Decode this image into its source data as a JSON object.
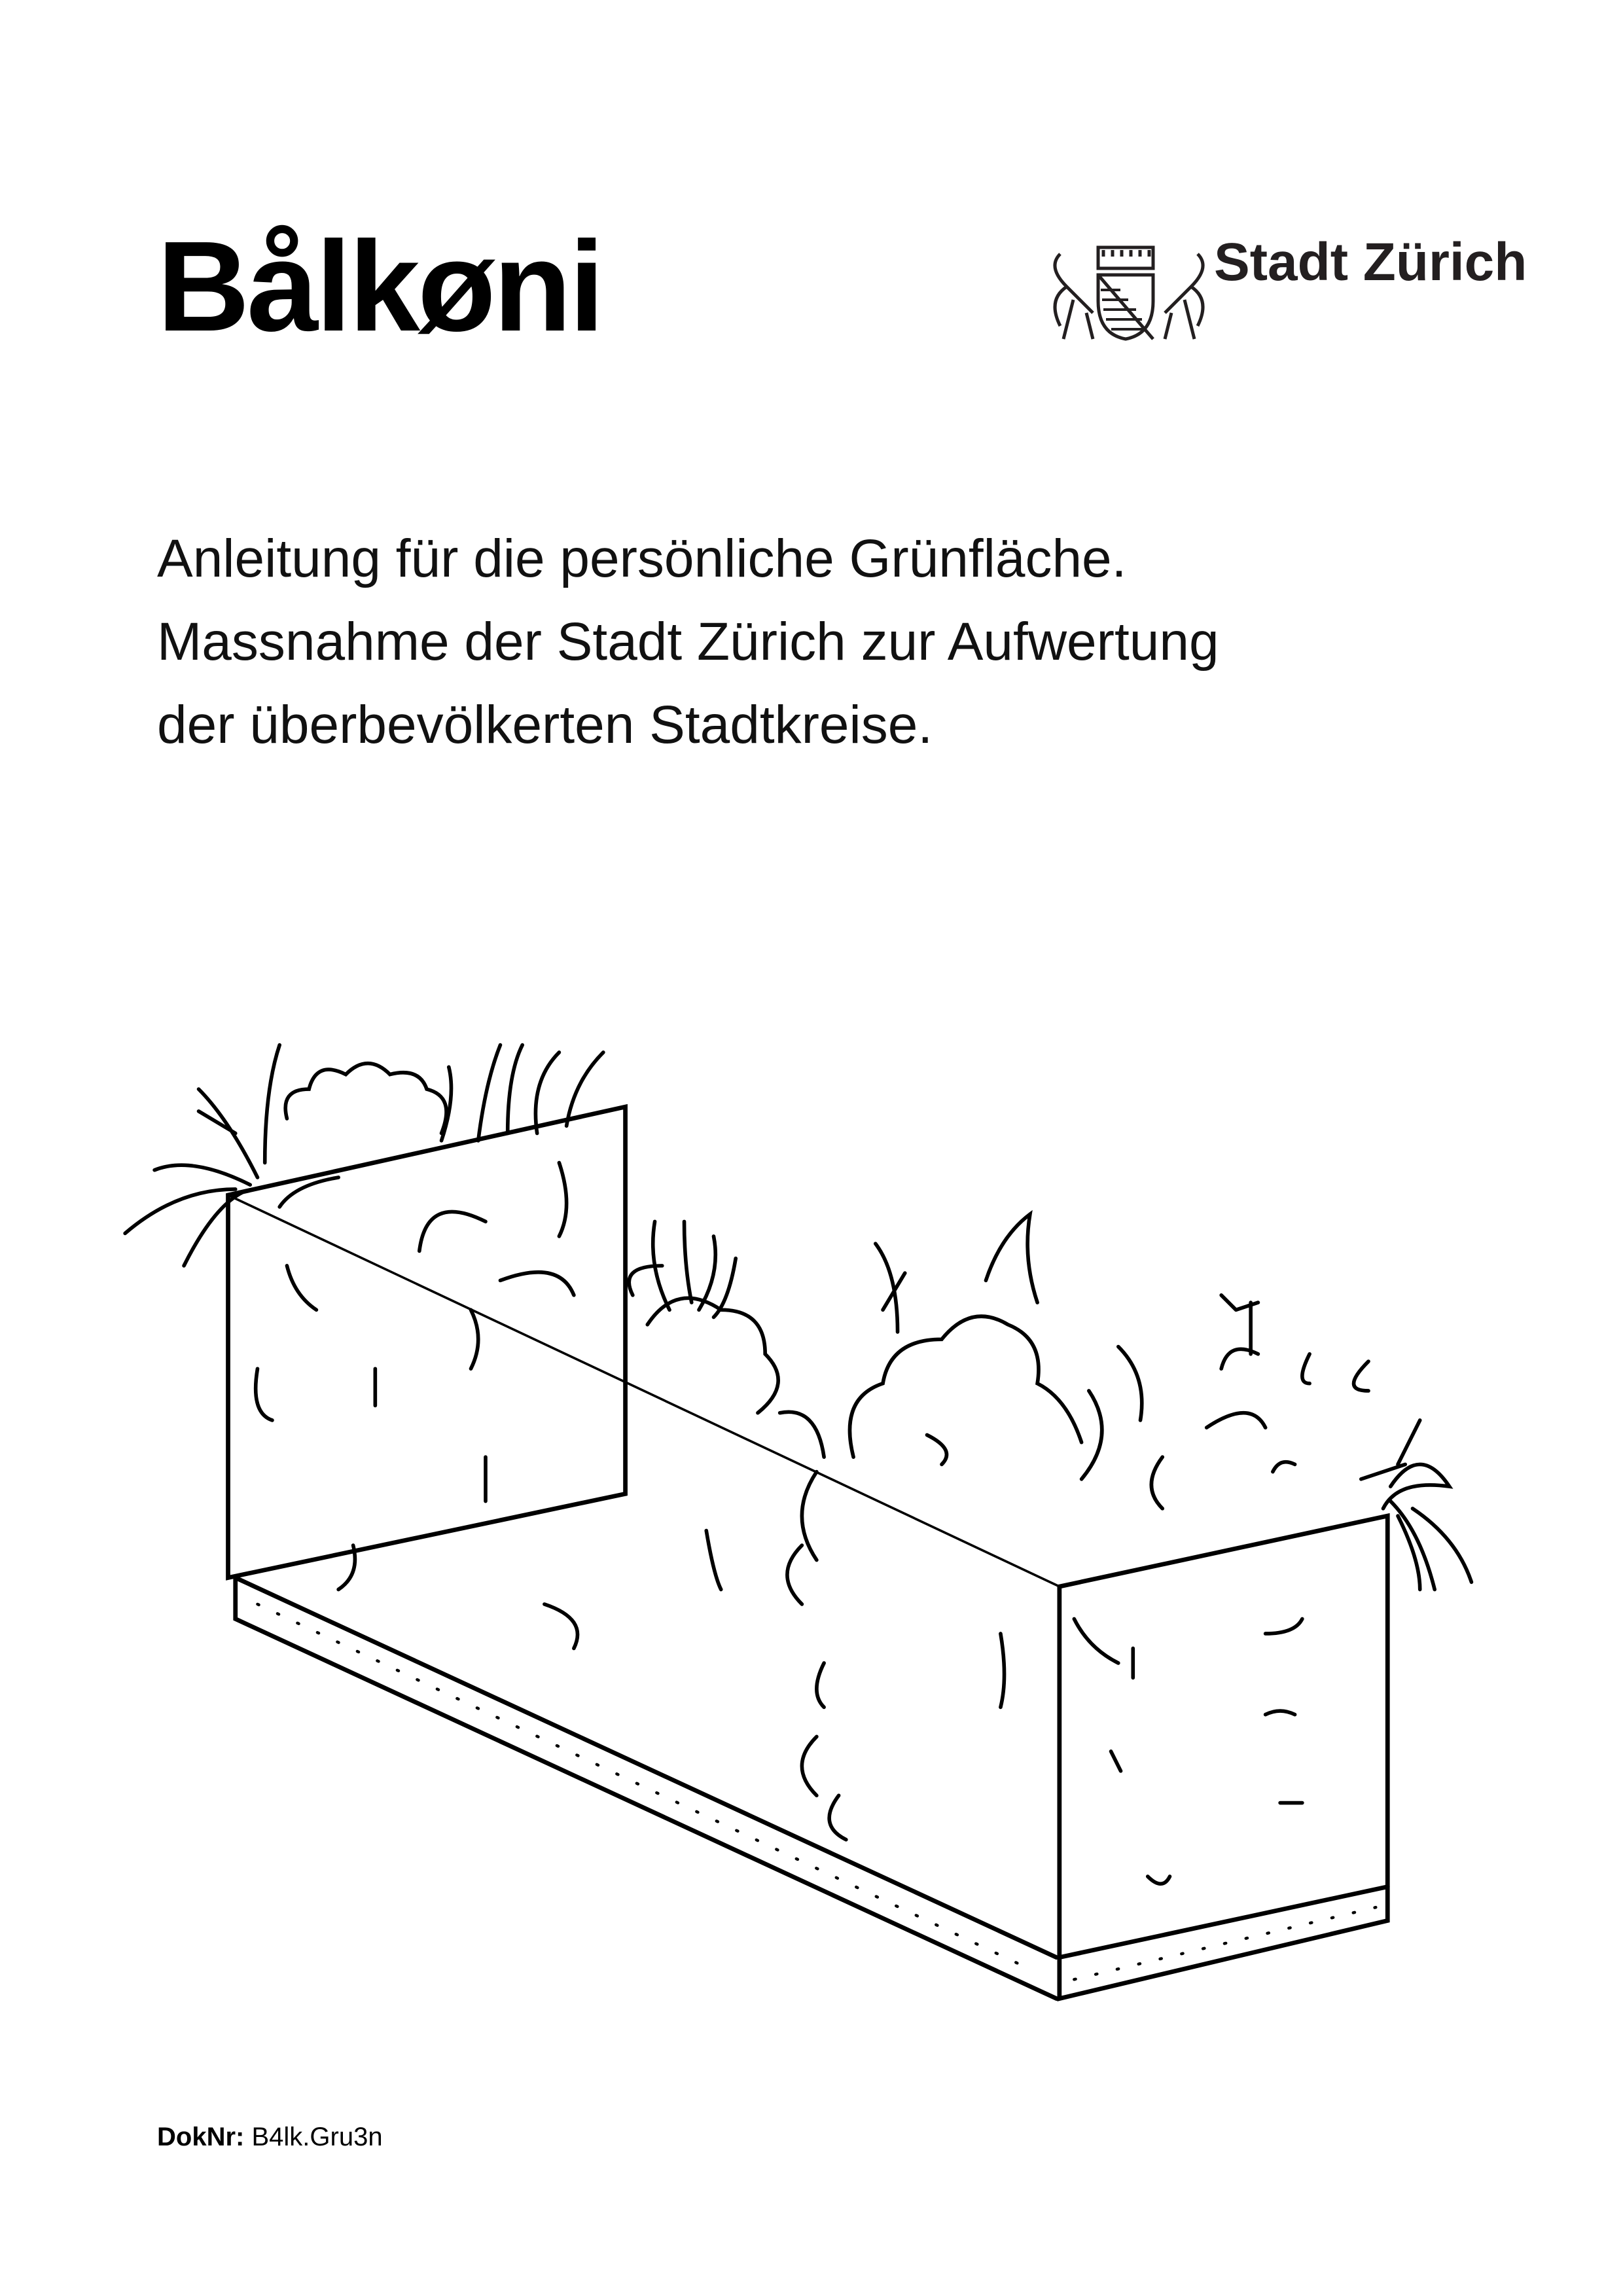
{
  "header": {
    "title": "Bålkøni",
    "logo_text": "Stadt Zürich"
  },
  "intro": {
    "lines": [
      "Anleitung für die persönliche Grünfläche.",
      "Massnahme der Stadt Zürich zur Aufwertung",
      "der überbevölkerten Stadtkreise."
    ]
  },
  "footer": {
    "label": "DokNr:",
    "value": "B4lk.Gru3n"
  }
}
